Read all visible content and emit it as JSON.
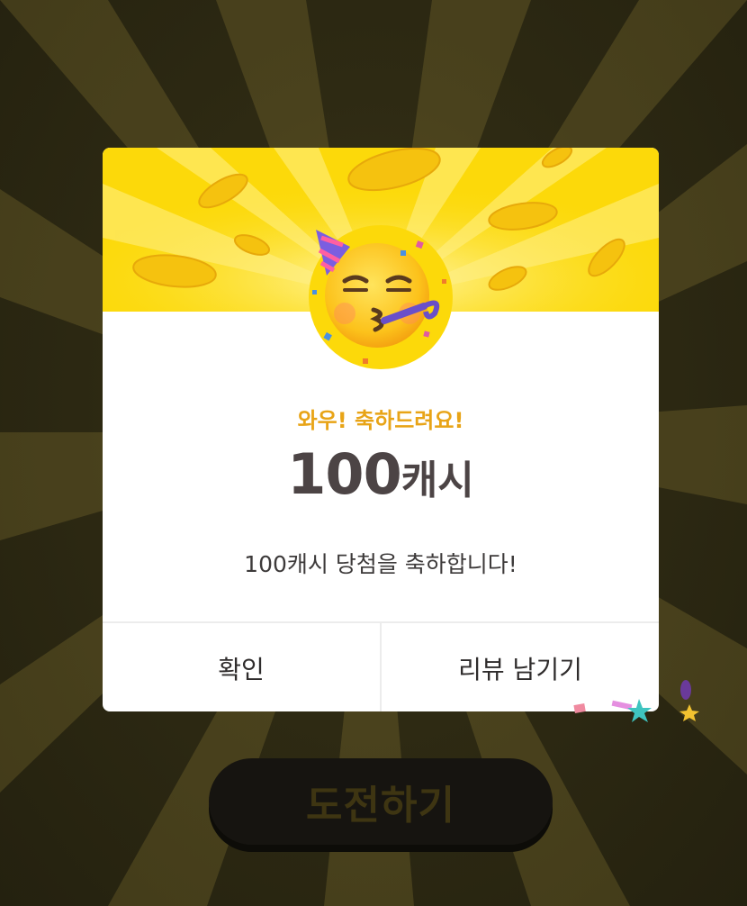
{
  "background": {
    "challenge_button_label": "도전하기"
  },
  "dialog": {
    "emoji_icon": "partying-face-icon",
    "subtitle": "와우! 축하드려요!",
    "amount_number": "100",
    "amount_unit": "캐시",
    "message": "100캐시 당첨을 축하합니다!",
    "buttons": {
      "confirm_label": "확인",
      "review_label": "리뷰 남기기"
    }
  },
  "colors": {
    "header_yellow": "#fcd90a",
    "subtitle_orange": "#e8a417",
    "amount_text": "#4c4445",
    "overlay_dark": "#2e2a13"
  }
}
